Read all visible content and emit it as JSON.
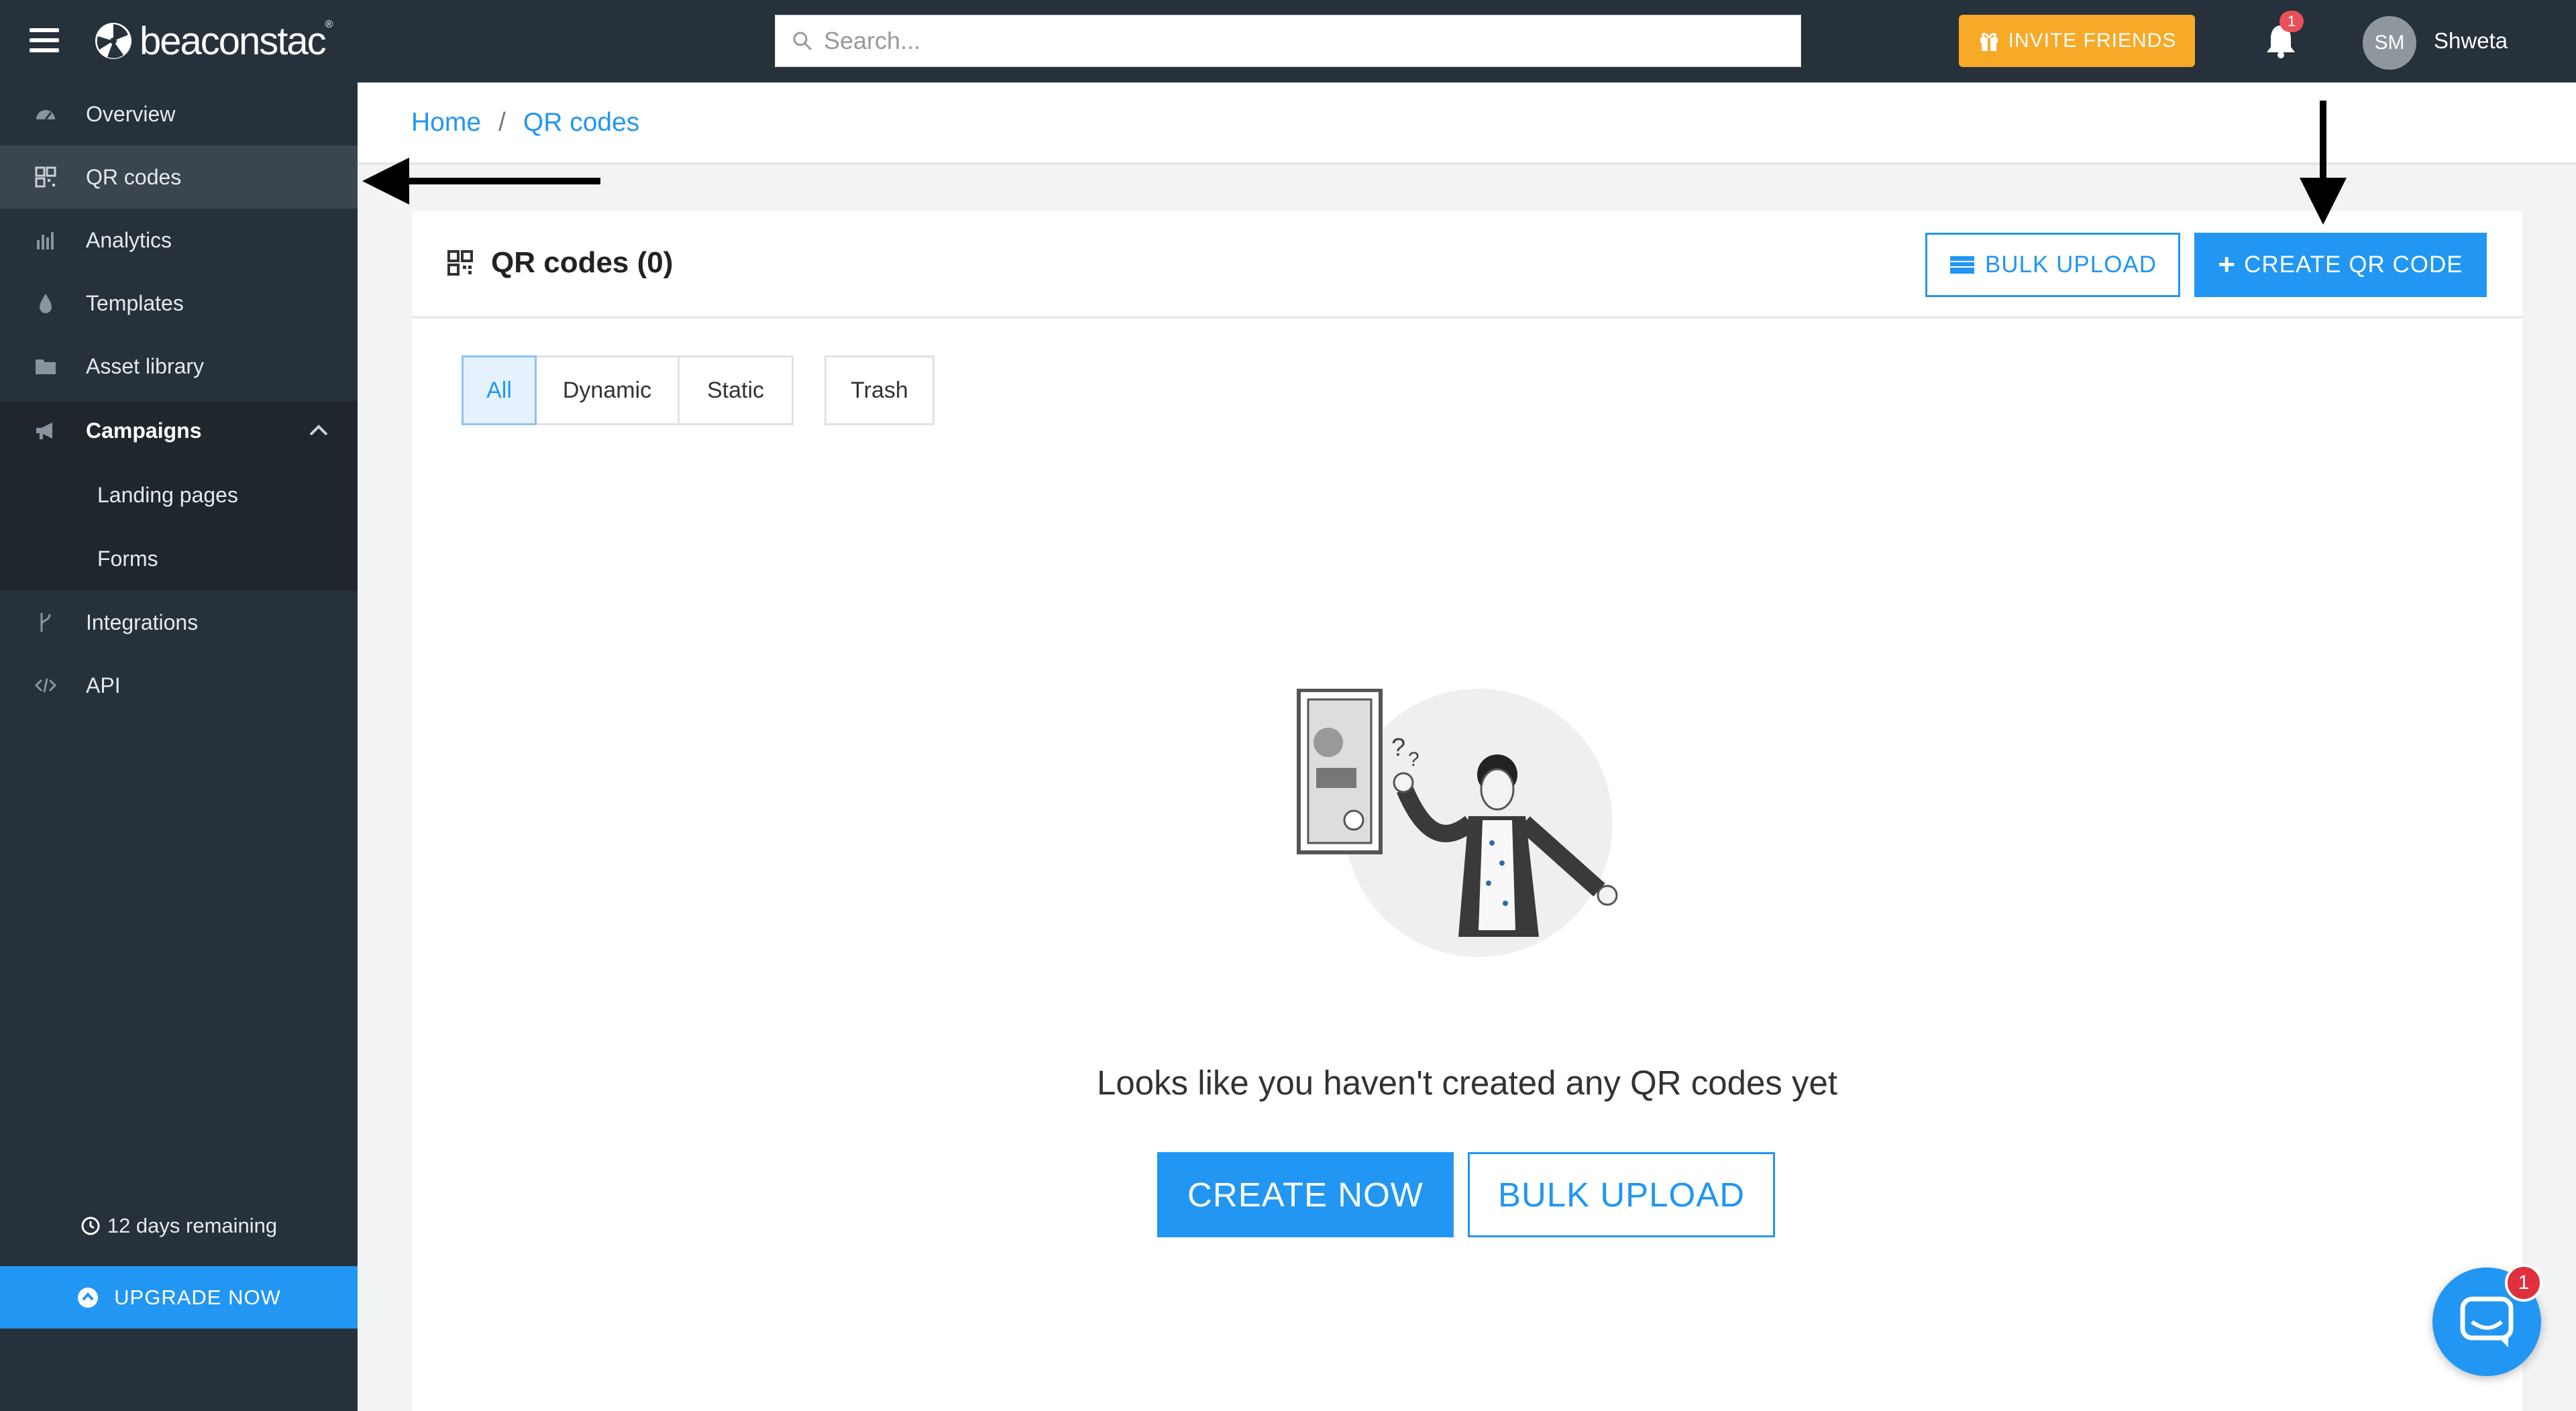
{
  "brand": {
    "name": "beaconstac",
    "trademark": "®"
  },
  "header": {
    "search_placeholder": "Search...",
    "invite_label": "INVITE FRIENDS",
    "notification_count": "1",
    "user_initials": "SM",
    "user_name": "Shweta"
  },
  "sidebar": {
    "items": [
      {
        "label": "Overview",
        "icon": "dashboard-icon"
      },
      {
        "label": "QR codes",
        "icon": "qr-code-icon"
      },
      {
        "label": "Analytics",
        "icon": "bar-chart-icon"
      },
      {
        "label": "Templates",
        "icon": "drop-icon"
      },
      {
        "label": "Asset library",
        "icon": "folder-icon"
      },
      {
        "label": "Campaigns",
        "icon": "megaphone-icon"
      },
      {
        "label": "Integrations",
        "icon": "branch-icon"
      },
      {
        "label": "API",
        "icon": "code-icon"
      }
    ],
    "campaign_sub": [
      "Landing pages",
      "Forms"
    ],
    "trial_text": "12 days remaining",
    "upgrade_label": "UPGRADE NOW"
  },
  "breadcrumb": {
    "home": "Home",
    "separator": "/",
    "current": "QR codes"
  },
  "main": {
    "title": "QR codes (0)",
    "bulk_upload_label": "BULK UPLOAD",
    "create_label": "CREATE QR CODE",
    "filters": [
      "All",
      "Dynamic",
      "Static",
      "Trash"
    ],
    "selected_filter": "All",
    "empty_message": "Looks like you haven't created any QR codes yet",
    "create_now_label": "CREATE NOW",
    "bulk_upload_now_label": "BULK UPLOAD"
  },
  "chat": {
    "badge": "1"
  },
  "colors": {
    "accent": "#2196f3",
    "sidebar": "#27313c",
    "invite": "#f7a928",
    "badge": "#e0303d"
  }
}
